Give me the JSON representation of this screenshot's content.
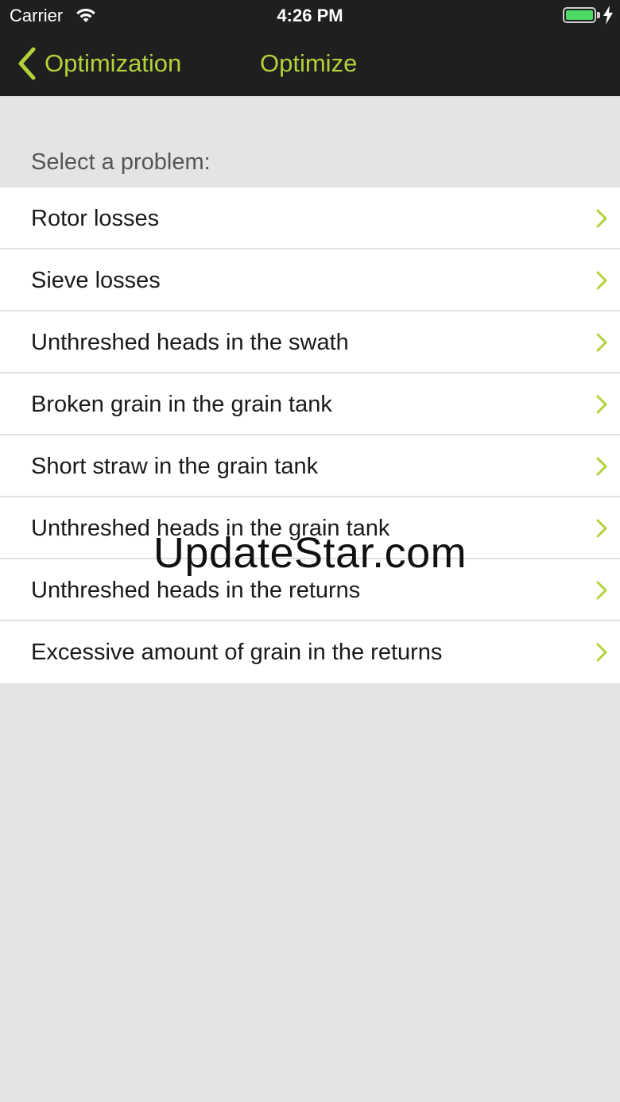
{
  "status_bar": {
    "carrier": "Carrier",
    "time": "4:26 PM",
    "wifi_icon": "wifi-icon",
    "battery_icon": "battery-icon",
    "charging_icon": "bolt-icon",
    "battery_color": "#4cd964"
  },
  "nav": {
    "back_label": "Optimization",
    "title": "Optimize",
    "accent_color": "#b3d23a",
    "back_icon": "chevron-left-icon"
  },
  "section": {
    "header": "Select a problem:"
  },
  "problems": [
    {
      "label": "Rotor losses"
    },
    {
      "label": "Sieve losses"
    },
    {
      "label": "Unthreshed heads in the swath"
    },
    {
      "label": "Broken grain in the grain tank"
    },
    {
      "label": "Short straw in the grain tank"
    },
    {
      "label": "Unthreshed heads in the grain tank"
    },
    {
      "label": "Unthreshed heads in the returns"
    },
    {
      "label": "Excessive amount of grain in the returns"
    }
  ],
  "watermark": "UpdateStar.com"
}
